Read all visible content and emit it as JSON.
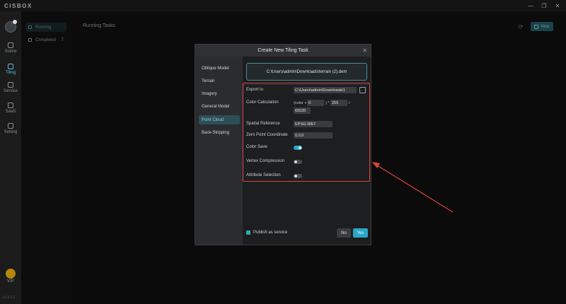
{
  "app": {
    "logo": "CISBOX"
  },
  "window_controls": {
    "minimize": "—",
    "restore": "❐",
    "close": "✕"
  },
  "leftnav": {
    "items": [
      {
        "label": "Scene"
      },
      {
        "label": "Tiling"
      },
      {
        "label": "Service"
      },
      {
        "label": "SaaS"
      },
      {
        "label": "Setting"
      }
    ],
    "vip_label": "VIP",
    "version": "v1.0.0.1"
  },
  "sidebar": {
    "items": [
      {
        "label": "Running"
      },
      {
        "label": "Completed",
        "count": "7"
      }
    ]
  },
  "main": {
    "title": "Running Tasks",
    "new_label": "New",
    "refresh_glyph": "⟳"
  },
  "modal": {
    "title": "Create New Tiling Task",
    "close_glyph": "✕",
    "tabs": [
      {
        "label": "Oblique Model"
      },
      {
        "label": "Terrain"
      },
      {
        "label": "Imagery"
      },
      {
        "label": "General Model"
      },
      {
        "label": "Point Cloud"
      },
      {
        "label": "Back-Stripping"
      }
    ],
    "file_path": "C:\\Users\\admin\\Downloads\\terrain (2).dem",
    "params": {
      "export_to_label": "Export to",
      "export_to_value": "C:\\Users\\admin\\Downloads\\1",
      "color_calc_label": "Color Calculation",
      "color_prefix": "(color +",
      "color_add": "0",
      "color_mul_sign": ") *",
      "color_mul": "255",
      "color_div_sign": "/",
      "color_div": "65535",
      "spatial_ref_label": "Spatial Reference",
      "spatial_ref_value": "EPSG:3857",
      "zero_point_label": "Zero Point Coordinate",
      "zero_point_value": "0,0,0",
      "color_save_label": "Color Save",
      "color_save_on": true,
      "vertex_comp_label": "Vertex Compression",
      "vertex_comp_on": false,
      "attr_sel_label": "Attribute Selection",
      "attr_sel_on": false
    },
    "publish_label": "Publish as service",
    "no_label": "No",
    "yes_label": "Yes"
  },
  "colors": {
    "accent": "#2aa8c9",
    "highlight": "#e0433a"
  }
}
